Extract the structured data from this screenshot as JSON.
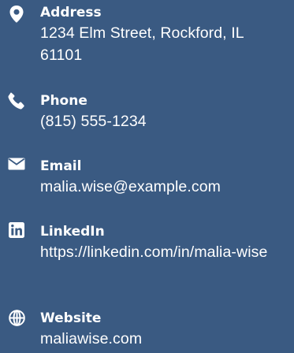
{
  "contacts": [
    {
      "icon": "location-pin-icon",
      "label": "Address",
      "value": "1234 Elm Street, Rockford, IL 61101"
    },
    {
      "icon": "phone-icon",
      "label": "Phone",
      "value": "(815) 555-1234"
    },
    {
      "icon": "envelope-icon",
      "label": "Email",
      "value": "malia.wise@example.com"
    },
    {
      "icon": "linkedin-icon",
      "label": "LinkedIn",
      "value": "https://linkedin.com/in/malia-wise"
    },
    {
      "icon": "globe-icon",
      "label": "Website",
      "value": "maliawise.com"
    }
  ],
  "colors": {
    "background": "#3a5a82",
    "text": "#ffffff"
  }
}
